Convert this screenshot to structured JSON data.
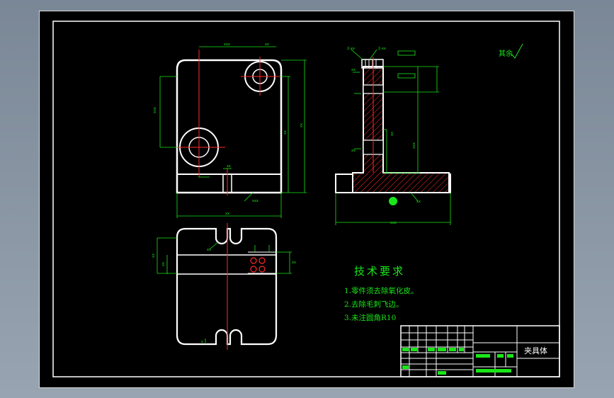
{
  "drawing": {
    "part_name": "夹具体",
    "roughness_note": "其余",
    "tech_requirements": {
      "title": "技术要求",
      "notes": [
        "1.零件须去除氧化皮。",
        "2.去除毛刺飞边。",
        "3.未注圆角R10"
      ]
    }
  },
  "colors": {
    "background": "#000000",
    "outline": "#ffffff",
    "dimension": "#19e619",
    "centerline": "#ff2a2a",
    "hatch": "#ff2a2a",
    "frame": "#ffffff",
    "window": "#8a96a4"
  }
}
